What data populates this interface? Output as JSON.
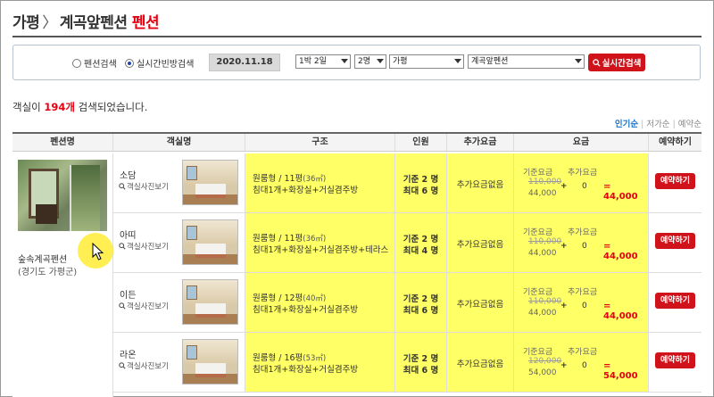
{
  "breadcrumb": {
    "region": "가평",
    "separator": "〉",
    "place": "계곡앞펜션",
    "category": "펜션"
  },
  "search": {
    "radio_options": [
      {
        "label": "펜션검색",
        "checked": false
      },
      {
        "label": "실시간빈방검색",
        "checked": true
      }
    ],
    "date": "2020.11.18",
    "stay": "1박 2일",
    "guests": "2명",
    "region": "가평",
    "theme": "계곡앞펜션",
    "submit_label": "실시간검색"
  },
  "result": {
    "prefix": "객실이 ",
    "count": "194개",
    "suffix": " 검색되었습니다."
  },
  "sort": {
    "options": [
      "인기순",
      "저가순",
      "예약순"
    ],
    "active": "인기순"
  },
  "table": {
    "headers": [
      "펜션명",
      "객실명",
      "구조",
      "인원",
      "추가요금",
      "요금",
      "예약하기"
    ],
    "pension": {
      "name": "숲속계곡펜션",
      "region": "(경기도 가평군)"
    },
    "photo_link_label": "객실사진보기",
    "price_label_base": "기준요금",
    "price_label_extra": "추가요금",
    "extra_fee_text": "추가요금없음",
    "book_label": "예약하기",
    "rows": [
      {
        "room": "소담",
        "struct_type": "원룸형 / 11평",
        "struct_area": "(36㎡)",
        "struct_desc": "침대1개+화장실+거실겸주방",
        "cap_base": "기준 2 명",
        "cap_max": "최대 6 명",
        "orig_price": "110,000",
        "base_price": "44,000",
        "plus": "+",
        "extra": "0",
        "total": "= 44,000"
      },
      {
        "room": "아띠",
        "struct_type": "원룸형 / 11평",
        "struct_area": "(36㎡)",
        "struct_desc": "침대1개+화장실+거실겸주방+테라스",
        "cap_base": "기준 2 명",
        "cap_max": "최대 4 명",
        "orig_price": "110,000",
        "base_price": "44,000",
        "plus": "+",
        "extra": "0",
        "total": "= 44,000"
      },
      {
        "room": "이든",
        "struct_type": "원룸형 / 12평",
        "struct_area": "(40㎡)",
        "struct_desc": "침대1개+화장실+거실겸주방",
        "cap_base": "기준 2 명",
        "cap_max": "최대 6 명",
        "orig_price": "110,000",
        "base_price": "44,000",
        "plus": "+",
        "extra": "0",
        "total": "= 44,000"
      },
      {
        "room": "라온",
        "struct_type": "원룸형 / 16평",
        "struct_area": "(53㎡)",
        "struct_desc": "침대1개+화장실+거실겸주방",
        "cap_base": "기준 2 명",
        "cap_max": "최대 6 명",
        "orig_price": "120,000",
        "base_price": "54,000",
        "plus": "+",
        "extra": "0",
        "total": "= 54,000"
      }
    ]
  },
  "colors": {
    "accent_red": "#e60012",
    "highlight_yellow": "#ffff66",
    "sort_active": "#1a73c8"
  }
}
